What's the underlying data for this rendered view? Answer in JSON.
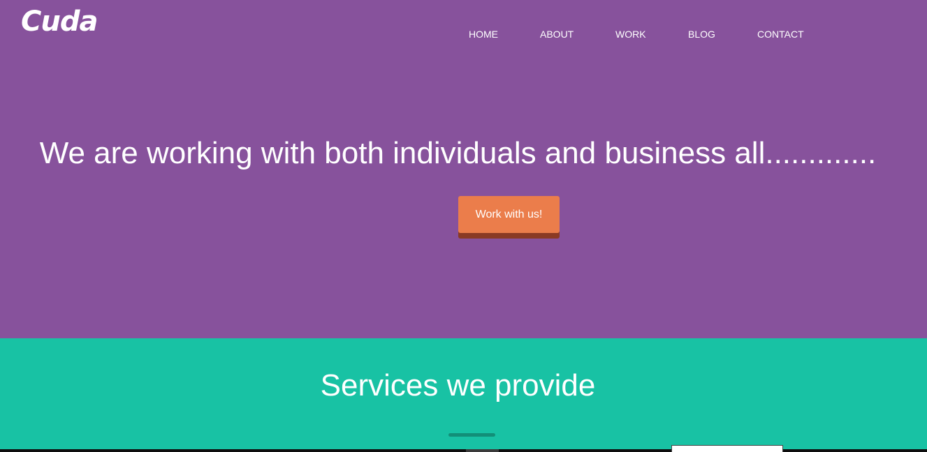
{
  "brand": {
    "logo_text": "Cuda"
  },
  "nav": {
    "items": [
      "HOME",
      "ABOUT",
      "WORK",
      "BLOG",
      "CONTACT"
    ]
  },
  "hero": {
    "headline": "We are working with both individuals and business all.............",
    "cta_label": "Work with us!"
  },
  "services": {
    "title": "Services we provide"
  },
  "colors": {
    "hero_bg": "#87529c",
    "services_bg": "#18c2a4",
    "cta_bg": "#eb7d4b",
    "cta_shadow": "#8a3a24",
    "divider": "#128f78",
    "text": "#ffffff"
  }
}
